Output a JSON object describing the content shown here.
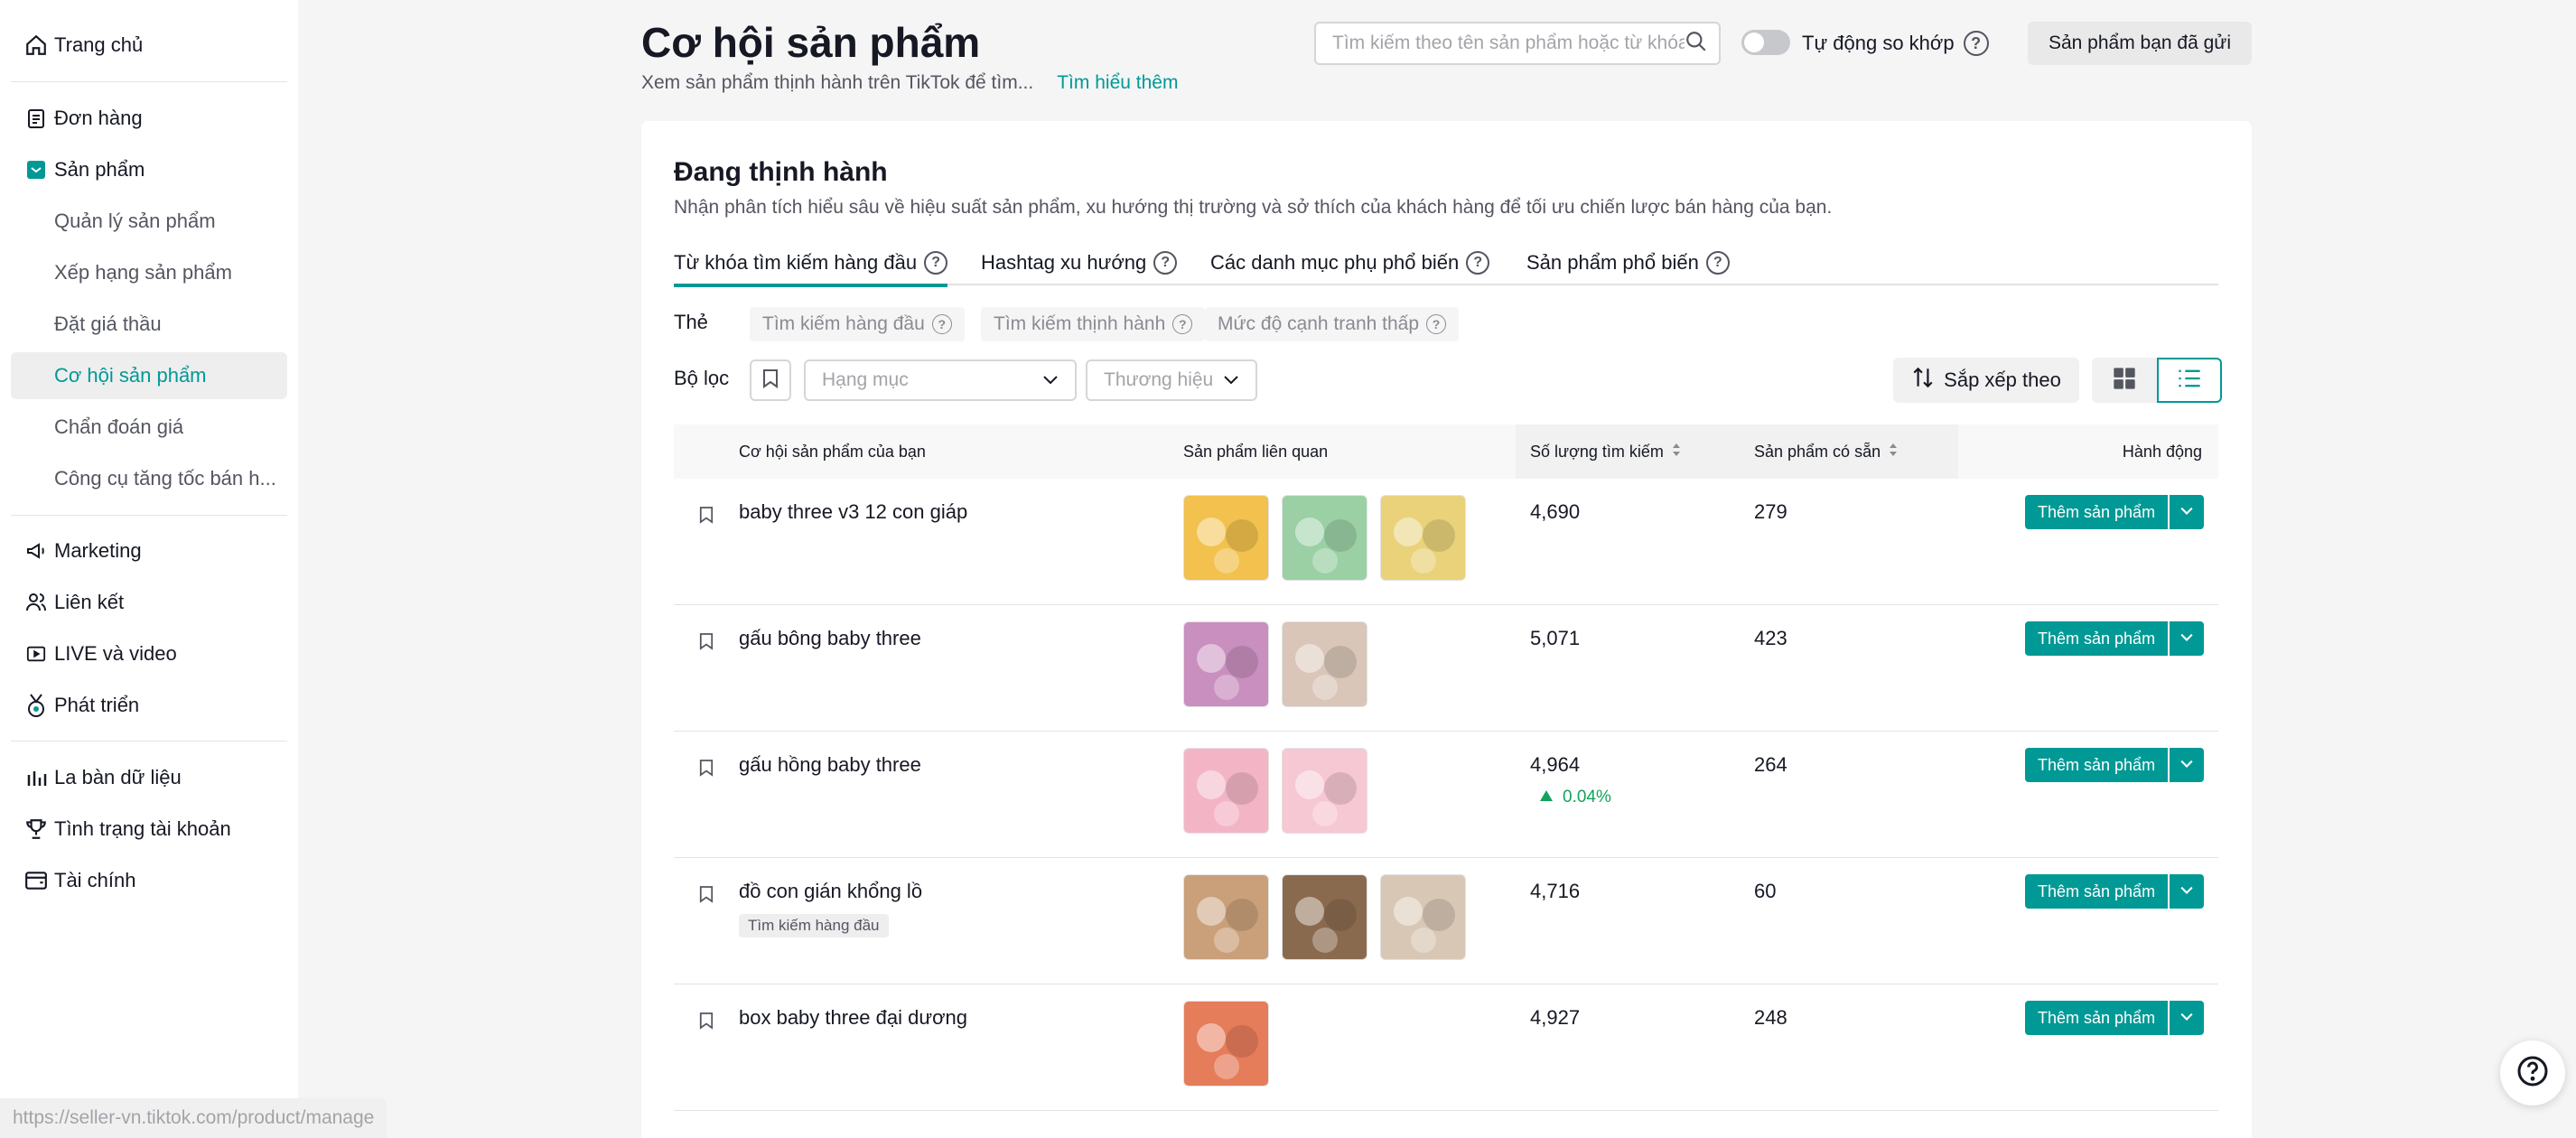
{
  "sidebar": {
    "items": [
      {
        "label": "Trang chủ",
        "icon": "home-icon"
      },
      {
        "label": "Đơn hàng",
        "icon": "clipboard-icon"
      },
      {
        "label": "Sản phẩm",
        "icon": "product-box-icon"
      },
      {
        "label": "Quản lý sản phẩm"
      },
      {
        "label": "Xếp hạng sản phẩm"
      },
      {
        "label": "Đặt giá thầu"
      },
      {
        "label": "Cơ hội sản phẩm"
      },
      {
        "label": "Chẩn đoán giá"
      },
      {
        "label": "Công cụ tăng tốc bán h..."
      },
      {
        "label": "Marketing",
        "icon": "megaphone-icon"
      },
      {
        "label": "Liên kết",
        "icon": "people-icon"
      },
      {
        "label": "LIVE và video",
        "icon": "live-video-icon"
      },
      {
        "label": "Phát triển",
        "icon": "growth-medal-icon"
      },
      {
        "label": "La bàn dữ liệu",
        "icon": "bar-chart-icon"
      },
      {
        "label": "Tình trạng tài khoản",
        "icon": "trophy-icon"
      },
      {
        "label": "Tài chính",
        "icon": "wallet-icon"
      }
    ]
  },
  "header": {
    "title": "Cơ hội sản phẩm",
    "subtitle": "Xem sản phẩm thịnh hành trên TikTok để tìm...",
    "learn_more": "Tìm hiểu thêm",
    "search_placeholder": "Tìm kiếm theo tên sản phẩm hoặc từ khóa",
    "auto_match_label": "Tự động so khớp",
    "sent_products_button": "Sản phẩm bạn đã gửi"
  },
  "card": {
    "title": "Đang thịnh hành",
    "description": "Nhận phân tích hiểu sâu về hiệu suất sản phẩm, xu hướng thị trường và sở thích của khách hàng để tối ưu chiến lược bán hàng của bạn.",
    "tabs": [
      {
        "label": "Từ khóa tìm kiếm hàng đầu"
      },
      {
        "label": "Hashtag xu hướng"
      },
      {
        "label": "Các danh mục phụ phổ biến"
      },
      {
        "label": "Sản phẩm phổ biến"
      }
    ],
    "tag_label": "Thẻ",
    "chips": [
      "Tìm kiếm hàng đầu",
      "Tìm kiếm thịnh hành",
      "Mức độ cạnh tranh thấp"
    ],
    "filter_label": "Bộ lọc",
    "category_placeholder": "Hạng mục",
    "brand_placeholder": "Thương hiệu",
    "sort_label": "Sắp xếp theo"
  },
  "table": {
    "headers": {
      "opportunity": "Cơ hội sản phẩm của bạn",
      "related": "Sản phẩm liên quan",
      "searches": "Số lượng tìm kiếm",
      "available": "Sản phẩm có sẵn",
      "action": "Hành động"
    },
    "rows": [
      {
        "keyword": "baby three v3 12 con giáp",
        "tag": "",
        "searches": "4,690",
        "trend": "",
        "available": "279",
        "thumbs": [
          "#f2c14e",
          "#9ad0a4",
          "#e9d27a"
        ]
      },
      {
        "keyword": "gấu bông baby three",
        "tag": "",
        "searches": "5,071",
        "trend": "",
        "available": "423",
        "thumbs": [
          "#c98fbf",
          "#d9c6b8"
        ]
      },
      {
        "keyword": "gấu hồng baby three",
        "tag": "",
        "searches": "4,964",
        "trend": "0.04%",
        "available": "264",
        "thumbs": [
          "#f3b5c6",
          "#f6c8d3"
        ]
      },
      {
        "keyword": "đồ con gián khổng lồ",
        "tag": "Tìm kiếm hàng đầu",
        "searches": "4,716",
        "trend": "",
        "available": "60",
        "thumbs": [
          "#c9a07a",
          "#8a6a4f",
          "#d8c7b5"
        ]
      },
      {
        "keyword": "box baby three đại dương",
        "tag": "",
        "searches": "4,927",
        "trend": "",
        "available": "248",
        "thumbs": [
          "#e57c5a"
        ]
      }
    ],
    "add_button": "Thêm sản phẩm"
  },
  "status_url": "https://seller-vn.tiktok.com/product/manage",
  "colors": {
    "accent": "#009995",
    "trend_up": "#13a35b"
  }
}
